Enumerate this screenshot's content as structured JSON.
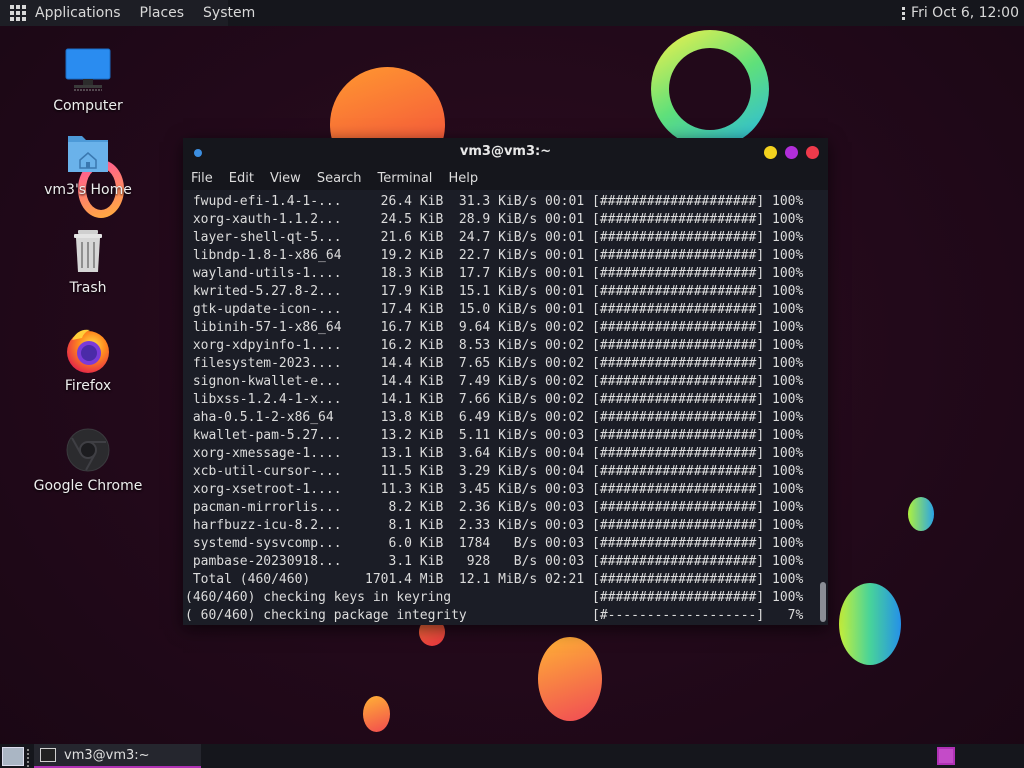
{
  "top_panel": {
    "applications": "Applications",
    "places": "Places",
    "system": "System",
    "clock": "Fri Oct  6, 12:00"
  },
  "desktop": {
    "icons": [
      {
        "label": "Computer",
        "icon": "computer-icon"
      },
      {
        "label": "vm3's Home",
        "icon": "home-folder-icon"
      },
      {
        "label": "Trash",
        "icon": "trash-icon"
      },
      {
        "label": "Firefox",
        "icon": "firefox-icon"
      },
      {
        "label": "Google Chrome",
        "icon": "chrome-icon"
      }
    ]
  },
  "terminal": {
    "title": "vm3@vm3:~",
    "menu": [
      "File",
      "Edit",
      "View",
      "Search",
      "Terminal",
      "Help"
    ],
    "lines": [
      " fwupd-efi-1.4-1-...     26.4 KiB  31.3 KiB/s 00:01 [####################] 100%",
      " xorg-xauth-1.1.2...     24.5 KiB  28.9 KiB/s 00:01 [####################] 100%",
      " layer-shell-qt-5...     21.6 KiB  24.7 KiB/s 00:01 [####################] 100%",
      " libndp-1.8-1-x86_64     19.2 KiB  22.7 KiB/s 00:01 [####################] 100%",
      " wayland-utils-1....     18.3 KiB  17.7 KiB/s 00:01 [####################] 100%",
      " kwrited-5.27.8-2...     17.9 KiB  15.1 KiB/s 00:01 [####################] 100%",
      " gtk-update-icon-...     17.4 KiB  15.0 KiB/s 00:01 [####################] 100%",
      " libinih-57-1-x86_64     16.7 KiB  9.64 KiB/s 00:02 [####################] 100%",
      " xorg-xdpyinfo-1....     16.2 KiB  8.53 KiB/s 00:02 [####################] 100%",
      " filesystem-2023....     14.4 KiB  7.65 KiB/s 00:02 [####################] 100%",
      " signon-kwallet-e...     14.4 KiB  7.49 KiB/s 00:02 [####################] 100%",
      " libxss-1.2.4-1-x...     14.1 KiB  7.66 KiB/s 00:02 [####################] 100%",
      " aha-0.5.1-2-x86_64      13.8 KiB  6.49 KiB/s 00:02 [####################] 100%",
      " kwallet-pam-5.27...     13.2 KiB  5.11 KiB/s 00:03 [####################] 100%",
      " xorg-xmessage-1....     13.1 KiB  3.64 KiB/s 00:04 [####################] 100%",
      " xcb-util-cursor-...     11.5 KiB  3.29 KiB/s 00:04 [####################] 100%",
      " xorg-xsetroot-1....     11.3 KiB  3.45 KiB/s 00:03 [####################] 100%",
      " pacman-mirrorlis...      8.2 KiB  2.36 KiB/s 00:03 [####################] 100%",
      " harfbuzz-icu-8.2...      8.1 KiB  2.33 KiB/s 00:03 [####################] 100%",
      " systemd-sysvcomp...      6.0 KiB  1784   B/s 00:03 [####################] 100%",
      " pambase-20230918...      3.1 KiB   928   B/s 00:03 [####################] 100%",
      " Total (460/460)       1701.4 MiB  12.1 MiB/s 02:21 [####################] 100%",
      "(460/460) checking keys in keyring                  [####################] 100%",
      "( 60/460) checking package integrity                [#-------------------]   7%"
    ]
  },
  "taskbar": {
    "task_label": "vm3@vm3:~"
  },
  "colors": {
    "accent": "#b031b5",
    "btn_yellow": "#f3d21e",
    "btn_purple": "#b12ed9",
    "btn_red": "#ee3a4b"
  }
}
